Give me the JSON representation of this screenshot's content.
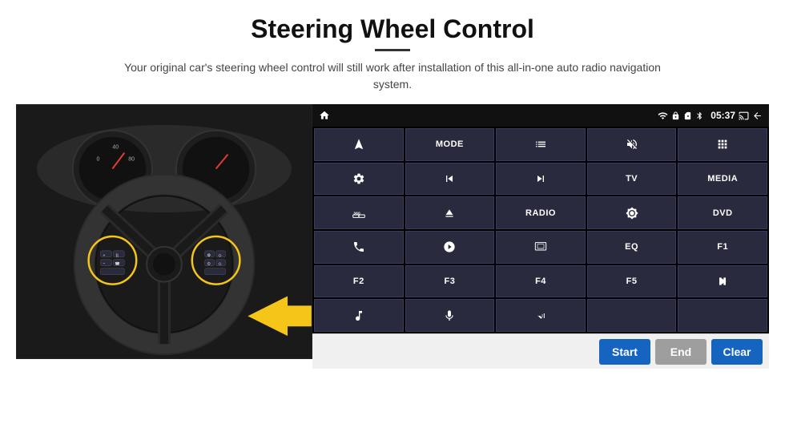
{
  "page": {
    "title": "Steering Wheel Control",
    "subtitle": "Your original car's steering wheel control will still work after installation of this all-in-one auto radio navigation system."
  },
  "status_bar": {
    "time": "05:37",
    "wifi_icon": "wifi",
    "lock_icon": "lock",
    "sim_icon": "sim",
    "bt_icon": "bluetooth",
    "battery_icon": "battery",
    "home_icon": "home",
    "back_icon": "back"
  },
  "grid_buttons": [
    {
      "id": "nav",
      "label": "",
      "icon": "navigate"
    },
    {
      "id": "mode",
      "label": "MODE",
      "icon": ""
    },
    {
      "id": "list",
      "label": "",
      "icon": "list"
    },
    {
      "id": "mute",
      "label": "",
      "icon": "mute"
    },
    {
      "id": "apps",
      "label": "",
      "icon": "apps"
    },
    {
      "id": "settings",
      "label": "",
      "icon": "settings"
    },
    {
      "id": "prev",
      "label": "",
      "icon": "prev"
    },
    {
      "id": "next",
      "label": "",
      "icon": "next"
    },
    {
      "id": "tv",
      "label": "TV",
      "icon": ""
    },
    {
      "id": "media",
      "label": "MEDIA",
      "icon": ""
    },
    {
      "id": "cam360",
      "label": "",
      "icon": "cam360"
    },
    {
      "id": "eject",
      "label": "",
      "icon": "eject"
    },
    {
      "id": "radio",
      "label": "RADIO",
      "icon": ""
    },
    {
      "id": "bright",
      "label": "",
      "icon": "brightness"
    },
    {
      "id": "dvd",
      "label": "DVD",
      "icon": ""
    },
    {
      "id": "phone",
      "label": "",
      "icon": "phone"
    },
    {
      "id": "explore",
      "label": "",
      "icon": "explore"
    },
    {
      "id": "screen",
      "label": "",
      "icon": "screen"
    },
    {
      "id": "eq",
      "label": "EQ",
      "icon": ""
    },
    {
      "id": "f1",
      "label": "F1",
      "icon": ""
    },
    {
      "id": "f2",
      "label": "F2",
      "icon": ""
    },
    {
      "id": "f3",
      "label": "F3",
      "icon": ""
    },
    {
      "id": "f4",
      "label": "F4",
      "icon": ""
    },
    {
      "id": "f5",
      "label": "F5",
      "icon": ""
    },
    {
      "id": "playpause",
      "label": "",
      "icon": "playpause"
    },
    {
      "id": "music",
      "label": "",
      "icon": "music"
    },
    {
      "id": "mic",
      "label": "",
      "icon": "mic"
    },
    {
      "id": "volphone",
      "label": "",
      "icon": "volphone"
    },
    {
      "id": "empty1",
      "label": "",
      "icon": ""
    },
    {
      "id": "empty2",
      "label": "",
      "icon": ""
    }
  ],
  "action_bar": {
    "start_label": "Start",
    "end_label": "End",
    "clear_label": "Clear"
  }
}
